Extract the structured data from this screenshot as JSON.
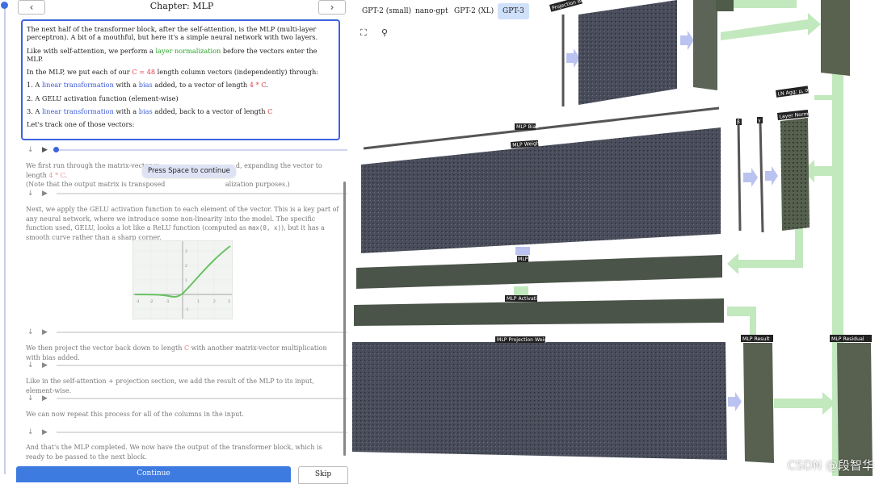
{
  "chapter": {
    "title": "Chapter: MLP",
    "prev_icon": "chevron-left-icon",
    "next_icon": "chevron-right-icon"
  },
  "current": {
    "p1": "The next half of the transformer block, after the self-attention, is the MLP (multi-layer perceptron). A bit of a mouthful, but here it's a simple neural network with two layers.",
    "p2_a": "Like with self-attention, we perform a ",
    "p2_b": "layer normalization",
    "p2_c": " before the vectors enter the MLP.",
    "p3_a": "In the MLP, we put each of our ",
    "p3_b": "C = 48",
    "p3_c": " length column vectors (independently) through:",
    "p4_a": "1. A ",
    "p4_b": "linear transformation",
    "p4_c": " with a ",
    "p4_d": "bias",
    "p4_e": " added, to a vector of length ",
    "p4_f": "4 * C",
    "p4_g": ".",
    "p5": "2. A GELU activation function (element-wise)",
    "p6_a": "3. A ",
    "p6_b": "linear transformation",
    "p6_c": " with a ",
    "p6_d": "bias",
    "p6_e": " added, back to a vector of length ",
    "p6_f": "C",
    "p7": "Let's track one of those vectors:"
  },
  "steps": {
    "s1_a": "We first run through the matrix-vector m",
    "s1_b": "d, expanding the vector to length ",
    "s1_c": "4 * C",
    "s1_d": ".",
    "s1_e": "(Note that the output matrix is transposed ",
    "s1_f": "alization purposes.)",
    "s2_a": "Next, we apply the GELU activation function to each element of the vector. This is a key part of any neural network, where we introduce some non-linearity into the model. The specific function used, GELU, looks a lot like a ReLU function (computed as ",
    "s2_code": "max(0, x)",
    "s2_b": "), but it has a smooth curve rather than a sharp corner.",
    "s3_a": "We then project the vector back down to length ",
    "s3_b": "C",
    "s3_c": " with another matrix-vector multiplication with bias added.",
    "s4": "Like in the self-attention + projection section, we add the result of the MLP to its input, element-wise.",
    "s5": "We can now repeat this process for all of the columns in the input.",
    "s6": "And that's the MLP completed. We now have the output of the transformer block, which is ready to be passed to the next block."
  },
  "tooltip": "Press Space to continue",
  "gelu_chart": {
    "x_ticks": [
      "-3",
      "-2",
      "-1",
      "1",
      "2",
      "3"
    ],
    "y_ticks": [
      "3",
      "2",
      "1",
      "-1"
    ]
  },
  "buttons": {
    "continue": "Continue",
    "skip": "Skip"
  },
  "models": [
    {
      "label": "GPT-2 (small)",
      "active": false
    },
    {
      "label": "nano-gpt",
      "active": false
    },
    {
      "label": "GPT-2 (XL)",
      "active": false
    },
    {
      "label": "GPT-3",
      "active": true
    }
  ],
  "tools": {
    "fullscreen_icon": "fullscreen-icon",
    "search_icon": "search-icon"
  },
  "labels": {
    "projection_bias": "Projection Bias",
    "mlp_bias": "MLP Bias",
    "mlp_weights": "MLP Weights",
    "ln_agg": "LN Agg: μ, σ",
    "layer_norm": "Layer Norm",
    "beta": "β",
    "gamma": "γ",
    "mlp": "MLP",
    "mlp_activation": "MLP Activation",
    "mlp_projection_weights": "MLP Projection Weights",
    "mlp_result": "MLP Result",
    "mlp_residual": "MLP Residual"
  },
  "colors": {
    "accent": "#3d63dd",
    "matrix": "#4b4f5c",
    "green_arrow": "#b5e3b0",
    "purple_arrow": "#b9c2ee"
  },
  "watermark": "CSDN @段智华"
}
